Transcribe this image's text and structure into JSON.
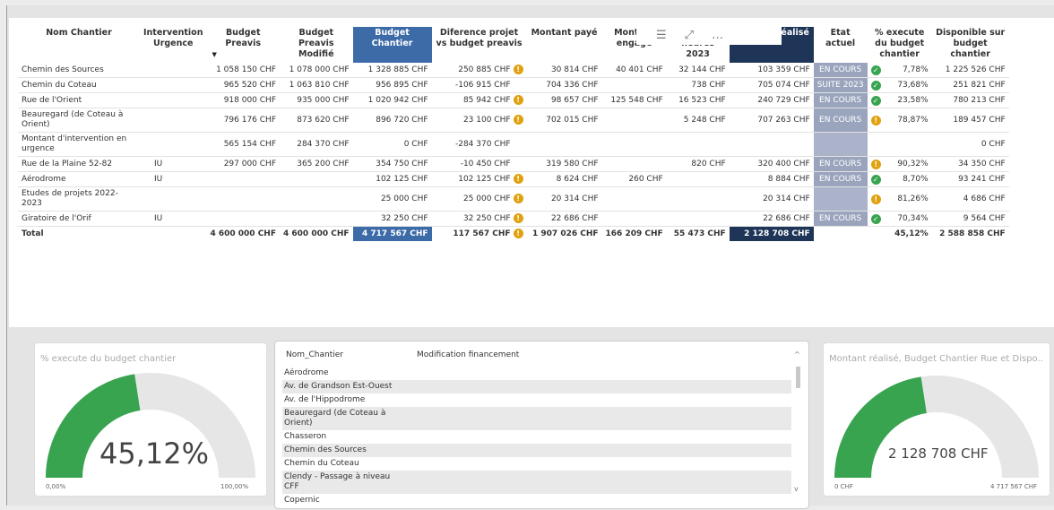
{
  "table": {
    "headers": [
      "Nom Chantier",
      "Intervention Urgence",
      "Budget Preavis",
      "Budget Preavis Modifié",
      "Budget Chantier",
      "Diference projet vs budget preavis",
      "Montant payé",
      "Montant engagé",
      "Montant heures 2023",
      "Montant réalisé",
      "Etat actuel",
      "% execute du budget chantier",
      "Disponible sur budget chantier"
    ],
    "rows": [
      {
        "name": "Chemin des Sources",
        "urg": "",
        "bp": "1 058 150 CHF",
        "bpm": "1 078 000 CHF",
        "bc": "1 328 885 CHF",
        "diff": "250 885 CHF",
        "diff_icon": "warn",
        "paye": "30 814 CHF",
        "engage": "40 401 CHF",
        "heures": "32 144 CHF",
        "realise": "103 359 CHF",
        "etat": "EN COURS",
        "pct_icon": "ok",
        "pct": "7,78%",
        "dispo": "1 225 526 CHF"
      },
      {
        "name": "Chemin du Coteau",
        "urg": "",
        "bp": "965 520 CHF",
        "bpm": "1 063 810 CHF",
        "bc": "956 895 CHF",
        "diff": "-106 915 CHF",
        "diff_icon": "",
        "paye": "704 336 CHF",
        "engage": "",
        "heures": "738 CHF",
        "realise": "705 074 CHF",
        "etat": "SUITE 2023",
        "pct_icon": "ok",
        "pct": "73,68%",
        "dispo": "251 821 CHF"
      },
      {
        "name": "Rue de l'Orient",
        "urg": "",
        "bp": "918 000 CHF",
        "bpm": "935 000 CHF",
        "bc": "1 020 942 CHF",
        "diff": "85 942 CHF",
        "diff_icon": "warn",
        "paye": "98 657 CHF",
        "engage": "125 548 CHF",
        "heures": "16 523 CHF",
        "realise": "240 729 CHF",
        "etat": "EN COURS",
        "pct_icon": "ok",
        "pct": "23,58%",
        "dispo": "780 213 CHF"
      },
      {
        "name": "Beauregard (de Coteau à Orient)",
        "urg": "",
        "bp": "796 176 CHF",
        "bpm": "873 620 CHF",
        "bc": "896 720 CHF",
        "diff": "23 100 CHF",
        "diff_icon": "warn",
        "paye": "702 015 CHF",
        "engage": "",
        "heures": "5 248 CHF",
        "realise": "707 263 CHF",
        "etat": "EN COURS",
        "pct_icon": "warn",
        "pct": "78,87%",
        "dispo": "189 457 CHF"
      },
      {
        "name": "Montant d'intervention en urgence",
        "urg": "",
        "bp": "565 154 CHF",
        "bpm": "284 370 CHF",
        "bc": "0 CHF",
        "diff": "-284 370 CHF",
        "diff_icon": "",
        "paye": "",
        "engage": "",
        "heures": "",
        "realise": "",
        "etat": "",
        "pct_icon": "",
        "pct": "",
        "dispo": "0 CHF"
      },
      {
        "name": "Rue de la Plaine 52-82",
        "urg": "IU",
        "bp": "297 000 CHF",
        "bpm": "365 200 CHF",
        "bc": "354 750 CHF",
        "diff": "-10 450 CHF",
        "diff_icon": "",
        "paye": "319 580 CHF",
        "engage": "",
        "heures": "820 CHF",
        "realise": "320 400 CHF",
        "etat": "EN COURS",
        "pct_icon": "warn",
        "pct": "90,32%",
        "dispo": "34 350 CHF"
      },
      {
        "name": "Aérodrome",
        "urg": "IU",
        "bp": "",
        "bpm": "",
        "bc": "102 125 CHF",
        "diff": "102 125 CHF",
        "diff_icon": "warn",
        "paye": "8 624 CHF",
        "engage": "260 CHF",
        "heures": "",
        "realise": "8 884 CHF",
        "etat": "EN COURS",
        "pct_icon": "ok",
        "pct": "8,70%",
        "dispo": "93 241 CHF"
      },
      {
        "name": "Etudes de projets 2022-2023",
        "urg": "",
        "bp": "",
        "bpm": "",
        "bc": "25 000 CHF",
        "diff": "25 000 CHF",
        "diff_icon": "warn",
        "paye": "20 314 CHF",
        "engage": "",
        "heures": "",
        "realise": "20 314 CHF",
        "etat": "",
        "pct_icon": "warn",
        "pct": "81,26%",
        "dispo": "4 686 CHF"
      },
      {
        "name": "Giratoire de l'Orif",
        "urg": "IU",
        "bp": "",
        "bpm": "",
        "bc": "32 250 CHF",
        "diff": "32 250 CHF",
        "diff_icon": "warn",
        "paye": "22 686 CHF",
        "engage": "",
        "heures": "",
        "realise": "22 686 CHF",
        "etat": "EN COURS",
        "pct_icon": "ok",
        "pct": "70,34%",
        "dispo": "9 564 CHF"
      }
    ],
    "total": {
      "label": "Total",
      "bp": "4 600 000 CHF",
      "bpm": "4 600 000 CHF",
      "bc": "4 717 567 CHF",
      "diff": "117 567 CHF",
      "diff_icon": "warn",
      "paye": "1 907 026 CHF",
      "engage": "166 209 CHF",
      "heures": "55 473 CHF",
      "realise": "2 128 708 CHF",
      "pct": "45,12%",
      "dispo": "2 588 858 CHF"
    }
  },
  "icons": {
    "warn": "!",
    "ok": "✓"
  },
  "colors": {
    "budget_chantier": "#3c6ba8",
    "montant_realise": "#1e3558",
    "gauge_fill": "#39a44f",
    "warning": "#e0a10e",
    "ok": "#39a44f"
  },
  "gauge_left": {
    "title": "% execute du budget chantier",
    "value": "45,12%",
    "min": "0,00%",
    "max": "100,00%",
    "fraction": 0.4512
  },
  "gauge_right": {
    "title": "Montant réalisé, Budget Chantier Rue et Dispo...",
    "value": "2 128 708 CHF",
    "min": "0 CHF",
    "max": "4 717 567 CHF",
    "fraction": 0.4512
  },
  "list": {
    "col1": "Nom_Chantier",
    "col2": "Modification financement",
    "items": [
      "Aérodrome",
      "Av. de Grandson Est-Ouest",
      "Av. de l'Hippodrome",
      "Beauregard (de Coteau à Orient)",
      "Chasseron",
      "Chemin des Sources",
      "Chemin du Coteau",
      "Clendy - Passage à niveau CFF",
      "Copernic"
    ]
  }
}
